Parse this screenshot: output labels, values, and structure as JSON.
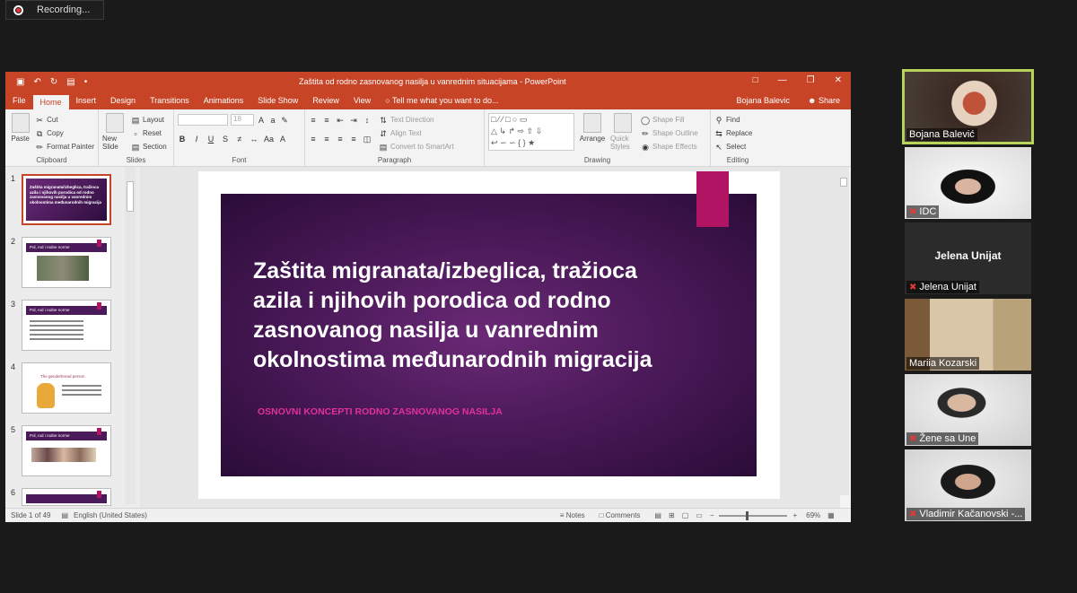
{
  "recording": {
    "label": "Recording..."
  },
  "ppt": {
    "title": "Zaštita od rodno zasnovanog nasilja u vanrednim situacijama - PowerPoint",
    "tabs": [
      "File",
      "Home",
      "Insert",
      "Design",
      "Transitions",
      "Animations",
      "Slide Show",
      "Review",
      "View"
    ],
    "tell_me": "Tell me what you want to do...",
    "user": "Bojana Balevic",
    "share": "Share",
    "ribbon": {
      "clipboard": {
        "paste": "Paste",
        "cut": "Cut",
        "copy": "Copy",
        "format_painter": "Format Painter",
        "label": "Clipboard"
      },
      "slides": {
        "new_slide": "New Slide",
        "layout": "Layout",
        "reset": "Reset",
        "section": "Section",
        "label": "Slides"
      },
      "font": {
        "size": "18",
        "label": "Font"
      },
      "paragraph": {
        "text_direction": "Text Direction",
        "align_text": "Align Text",
        "convert": "Convert to SmartArt",
        "label": "Paragraph"
      },
      "drawing": {
        "arrange": "Arrange",
        "quick_styles": "Quick Styles",
        "shape_fill": "Shape Fill",
        "shape_outline": "Shape Outline",
        "shape_effects": "Shape Effects",
        "label": "Drawing"
      },
      "editing": {
        "find": "Find",
        "replace": "Replace",
        "select": "Select",
        "label": "Editing"
      }
    },
    "thumbnails": [
      {
        "num": "1",
        "text": "Zaštita migranata/izbeglica, tražioca azila i njihovih porodica od rodno zasnovanog nasilja u vanrednim okolnostima međunarodnih migracija"
      },
      {
        "num": "2",
        "text": "Pol, rod i rodne norme"
      },
      {
        "num": "3",
        "text": "Pol, rod i rodne norme"
      },
      {
        "num": "4",
        "text": "The genderbread person"
      },
      {
        "num": "5",
        "text": "Pol, rod i rodne norme"
      },
      {
        "num": "6",
        "text": ""
      }
    ],
    "slide": {
      "title": "Zaštita migranata/izbeglica, tražioca azila i njihovih porodica od rodno zasnovanog nasilja u vanrednim okolnostima međunarodnih migracija",
      "subtitle": "OSNOVNI KONCEPTI RODNO ZASNOVANOG NASILJA"
    },
    "status": {
      "slide_count": "Slide 1 of 49",
      "language": "English (United States)",
      "notes": "Notes",
      "comments": "Comments",
      "zoom": "69%"
    }
  },
  "participants": [
    {
      "name": "Bojana Balević",
      "active": true,
      "muted": false
    },
    {
      "name": "IDC",
      "active": false,
      "muted": true
    },
    {
      "name": "Jelena Unijat",
      "active": false,
      "muted": true,
      "card": "Jelena Unijat"
    },
    {
      "name": "Mariia Kozarski",
      "active": false,
      "muted": false
    },
    {
      "name": "Žene sa Une",
      "active": false,
      "muted": true
    },
    {
      "name": "Vladimir Kačanovski -...",
      "active": false,
      "muted": true
    }
  ],
  "colors": {
    "ppt_accent": "#c74427",
    "slide_bg": "#4c1a5a",
    "slide_accent": "#b01462",
    "subtitle": "#e0309a",
    "active_speaker": "#b7d45a"
  }
}
